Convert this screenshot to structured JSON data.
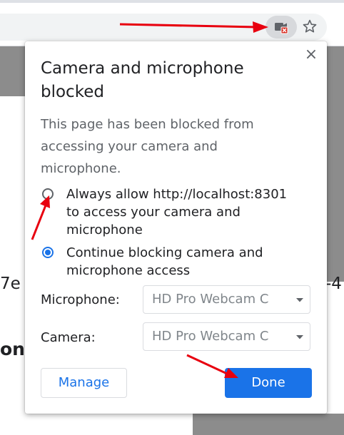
{
  "browser": {
    "toolbar_icons": [
      "camera-blocked-icon",
      "star-icon"
    ],
    "colors": {
      "omnibox_bg": "#f1f3f4",
      "badge_bg": "#d7d9dc"
    }
  },
  "page": {
    "fragment_left": "7e",
    "fragment_right": "-4",
    "fragment_heading": "ons"
  },
  "bubble": {
    "close_label": "×",
    "title": "Camera and microphone blocked",
    "description": "This page has been blocked from accessing your camera and microphone.",
    "options": [
      {
        "label": "Always allow http://localhost:8301 to access your camera and microphone",
        "selected": false
      },
      {
        "label": "Continue blocking camera and microphone access",
        "selected": true
      }
    ],
    "microphone": {
      "label": "Microphone:",
      "value": "HD Pro Webcam C"
    },
    "camera": {
      "label": "Camera:",
      "value": "HD Pro Webcam C"
    },
    "manage_label": "Manage",
    "done_label": "Done",
    "colors": {
      "accent": "#1a73e8",
      "text": "#202124",
      "secondary_text": "#5f6368"
    }
  },
  "annotations": {
    "arrow_color": "#e8000f",
    "count": 3
  }
}
